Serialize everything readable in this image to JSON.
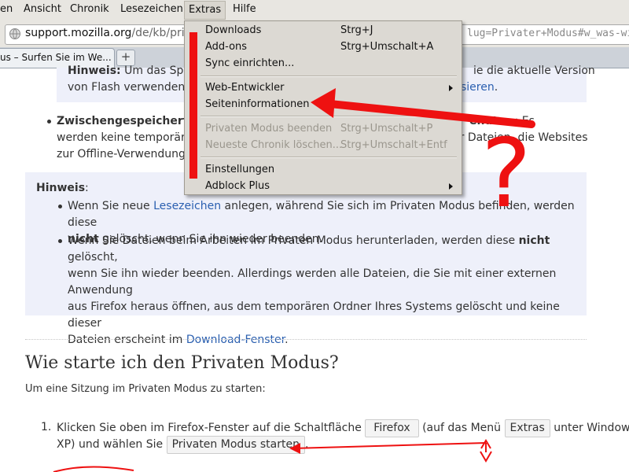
{
  "menubar": {
    "items": [
      "en",
      "Ansicht",
      "Chronik",
      "Lesezeichen",
      "Extras",
      "Hilfe"
    ]
  },
  "urlbar": {
    "url_host": "support.mozilla.org",
    "url_path": "/de/kb/private",
    "url_tail": "lug=Privater+Modus#w_was-wirc"
  },
  "tab": {
    "label": "us – Surfen Sie im We...",
    "add": "+"
  },
  "content": {
    "note1_bold": "Hinweis:",
    "note1_line1": "Um das Speic",
    "note1_line1_right": "ie die aktuelle Version",
    "note1_line2": "von Flash verwenden. N",
    "note1_line2_right_link": "sieren",
    "bullet_cache_bold": "Zwischengespeicherte",
    "bullet_cache_right_bold": "enutz",
    "bullet_cache_right": "...: Es",
    "bullet_cache_line2": "werden keine temporären",
    "bullet_cache_line2_right": "er Dateien, die Websites",
    "bullet_cache_line3": "zur Offline-Verwendung al",
    "hinweis_title": "Hinweis",
    "hinweis_b1_a": "Wenn Sie neue ",
    "hinweis_b1_link": "Lesezeichen",
    "hinweis_b1_b": " anlegen, während Sie sich im Privaten Modus befinden, werden diese",
    "hinweis_b1_bold": "nicht",
    "hinweis_b1_c": " gelöscht, wenn Sie ihn wieder beenden.",
    "hinweis_b2_a": "Wenn Sie Dateien beim Arbeiten im Privaten Modus herunterladen, werden diese ",
    "hinweis_b2_bold": "nicht",
    "hinweis_b2_b": " gelöscht,",
    "hinweis_b2_line2": "wenn Sie ihn wieder beenden. Allerdings werden alle Dateien, die Sie mit einer externen Anwendung",
    "hinweis_b2_line3": "aus Firefox heraus öffnen, aus dem temporären Ordner Ihres Systems gelöscht und keine dieser",
    "hinweis_b2_line4": "Dateien erscheint im ",
    "hinweis_b2_link": "Download-Fenster",
    "hinweis_b2_end": ".",
    "heading": "Wie starte ich den Privaten Modus?",
    "intro": "Um eine Sitzung im Privaten Modus zu starten:",
    "step_num": "1.",
    "step_a": "Klicken Sie oben im Firefox-Fenster auf die Schaltfläche",
    "step_btn1": "Firefox",
    "step_b": "(auf das Menü",
    "step_btn2": "Extras",
    "step_c": "unter Windows",
    "step_line2_a": "XP) und wählen Sie",
    "step_btn3": "Privaten Modus starten",
    "step_line2_end": "."
  },
  "menu": {
    "items": [
      {
        "label": "Downloads",
        "shortcut": "Strg+J",
        "disabled": false
      },
      {
        "label": "Add-ons",
        "shortcut": "Strg+Umschalt+A",
        "disabled": false
      },
      {
        "label": "Sync einrichten...",
        "shortcut": "",
        "disabled": false
      },
      {
        "label": "Web-Entwickler",
        "shortcut": "",
        "disabled": false
      },
      {
        "label": "Seiteninformationen",
        "shortcut": "",
        "disabled": false
      },
      {
        "label": "Privaten Modus beenden",
        "shortcut": "Strg+Umschalt+P",
        "disabled": true
      },
      {
        "label": "Neueste Chronik löschen...",
        "shortcut": "Strg+Umschalt+Entf",
        "disabled": true
      },
      {
        "label": "Einstellungen",
        "shortcut": "",
        "disabled": false
      },
      {
        "label": "Adblock Plus",
        "shortcut": "",
        "disabled": false
      }
    ]
  },
  "annotation": {
    "question_mark": "?",
    "color": "#ee1111"
  }
}
